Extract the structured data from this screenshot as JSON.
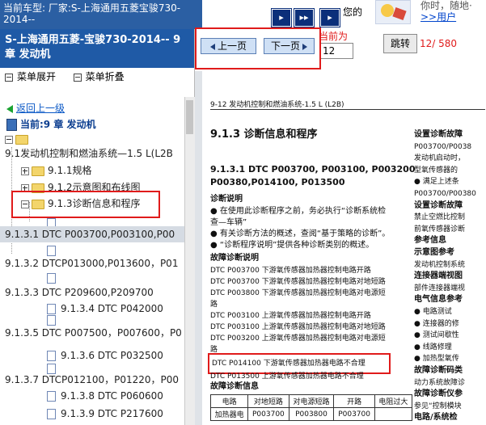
{
  "top": {
    "car_model": "当前车型: 厂家:S-上海通用五菱宝骏730-2014--",
    "nav_buttons": [
      "▸",
      "▸▸",
      "▸"
    ],
    "note": "您的",
    "link1": "你时，随地·",
    "link2": ">>用户"
  },
  "left": {
    "title": "S-上海通用五菱-宝骏730-2014-- 9章 发动机",
    "menu_expand": "菜单展开",
    "menu_collapse": "菜单折叠",
    "back": "返回上一级",
    "current": "当前:9 章 发动机",
    "tree": [
      {
        "text": "9.1发动机控制和燃油系统—1.5 L(L2B",
        "level": 0,
        "icon": "folder"
      },
      {
        "text": "9.1.1规格",
        "level": 1,
        "icon": "folder"
      },
      {
        "text": "9.1.2示意图和布线图",
        "level": 1,
        "icon": "folder"
      },
      {
        "text": "9.1.3诊断信息和程序",
        "level": 1,
        "icon": "folder"
      },
      {
        "text": "9.1.3.1 DTC P003700,P003100,P00",
        "level": 0,
        "icon": "none"
      },
      {
        "text": "9.1.3.2 DTCP013000,P013600，P01",
        "level": 0,
        "icon": "none"
      },
      {
        "text": "9.1.3.3 DTC P209600,P209700",
        "level": 0,
        "icon": "none"
      },
      {
        "text": "9.1.3.4 DTC P042000",
        "level": 2,
        "icon": "none"
      },
      {
        "text": "9.1.3.5 DTC P007500，P007600，P0",
        "level": 0,
        "icon": "none"
      },
      {
        "text": "9.1.3.6 DTC P032500",
        "level": 2,
        "icon": "none"
      },
      {
        "text": "9.1.3.7 DTCP012100，P01220，P00",
        "level": 0,
        "icon": "none"
      },
      {
        "text": "9.1.3.8 DTC P060600",
        "level": 2,
        "icon": "none"
      },
      {
        "text": "9.1.3.9 DTC P217600",
        "level": 2,
        "icon": "none"
      }
    ]
  },
  "viewer": {
    "prev": "上一页",
    "next": "下一页",
    "current_label": "当前为",
    "page_value": "12",
    "jump": "跳转",
    "page_count": "12/ 580"
  },
  "paper": {
    "header": "9-12 发动机控制和燃油系统-1.5 L (L2B)",
    "section_title": "9.1.3 诊断信息和程序",
    "dtc_title_1": "9.1.3.1 DTC P003700, P003100, P003200",
    "dtc_title_2": "P00380,P014100, P013500",
    "diag_heading": "诊断说明",
    "diag_lines": [
      "● 在使用此诊断程序之前，务必执行“诊断系统检",
      "   查—车辆”",
      "● 有关诊断方法的概述，查阅“基于策略的诊断”。",
      "● “诊断程序说明”提供各种诊断类别的概述。"
    ],
    "fault_heading": "故障诊断说明",
    "fault_lines": [
      "DTC P003700 下游氧传感器加热器控制电路开路",
      "DTC P003700 下游氧传感器加热器控制电路对地短路",
      "DTC P003800 下游氧传感器加热器控制电路对电源短",
      "路",
      "DTC P003100 上游氧传感器加热器控制电路开路",
      "DTC P003100 上游氧传感器加热器控制电路对地短路",
      "DTC P003200 上游氧传感器加热器控制电路对电源短",
      "路"
    ],
    "highlight_line": "DTC P014100 下游氧传感器加热器电路不合理",
    "after_line": "DTC P013500 上游氧传感器加热器电路不合理",
    "info_heading": "故障诊断信息",
    "table_head": [
      "电路",
      "对地短路",
      "对电源短路",
      "开路",
      "电阻过大"
    ],
    "table_row": [
      "加热器电",
      "P003700",
      "P003800",
      "P003700",
      ""
    ],
    "right_col": [
      {
        "t": "设置诊断故障",
        "b": true
      },
      {
        "t": "P003700/P0038",
        "b": false
      },
      {
        "t": "发动机启动时，",
        "b": false
      },
      {
        "t": "型氧传感器的",
        "b": false
      },
      {
        "t": "● 满足上述条",
        "b": false
      },
      {
        "t": "P003700/P00380",
        "b": false
      },
      {
        "t": "设置诊断故障",
        "b": true
      },
      {
        "t": "禁止空燃比控制",
        "b": false
      },
      {
        "t": "前氧传感器诊断",
        "b": false
      },
      {
        "t": "参考信息",
        "b": true
      },
      {
        "t": "示意图参考",
        "b": true
      },
      {
        "t": "发动机控制系统",
        "b": false
      },
      {
        "t": "连接器端视图",
        "b": true
      },
      {
        "t": "部件连接器端视",
        "b": false
      },
      {
        "t": "电气信息参考",
        "b": true
      },
      {
        "t": "● 电路测试",
        "b": false
      },
      {
        "t": "● 连接器的修",
        "b": false
      },
      {
        "t": "● 测试间歇性",
        "b": false
      },
      {
        "t": "● 线路修理",
        "b": false
      },
      {
        "t": "● 加热型氧传",
        "b": false
      },
      {
        "t": "故障诊断码类",
        "b": true
      },
      {
        "t": "动力系统故障诊",
        "b": false
      },
      {
        "t": "故障诊断仪参",
        "b": true
      },
      {
        "t": "参见“控制模块",
        "b": false
      },
      {
        "t": "电路/系统检",
        "b": true
      }
    ]
  }
}
